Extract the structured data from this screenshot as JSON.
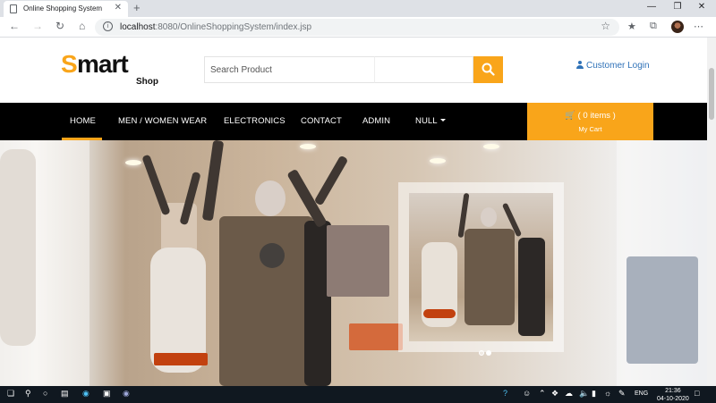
{
  "browser": {
    "tab_title": "Online Shopping System",
    "tab_close": "✕",
    "new_tab": "+",
    "url_host": "localhost",
    "url_rest": ":8080/OnlineShoppingSystem/index.jsp"
  },
  "header": {
    "logo_s": "S",
    "logo_mart": "mart",
    "logo_shop": "Shop",
    "search_placeholder": "Search Product",
    "customer_login": "Customer Login"
  },
  "nav": {
    "items": [
      {
        "label": "HOME"
      },
      {
        "label": "MEN / WOMEN WEAR"
      },
      {
        "label": "ELECTRONICS"
      },
      {
        "label": "CONTACT"
      },
      {
        "label": "ADMIN"
      },
      {
        "label": "NULL"
      }
    ]
  },
  "cart": {
    "items_label": "( 0 items )",
    "my_cart": "My Cart"
  },
  "taskbar": {
    "language": "ENG",
    "time": "21:36",
    "date": "04-10-2020"
  },
  "colors": {
    "accent": "#f9a51a",
    "nav_bg": "#000000",
    "link": "#2f72b8"
  }
}
